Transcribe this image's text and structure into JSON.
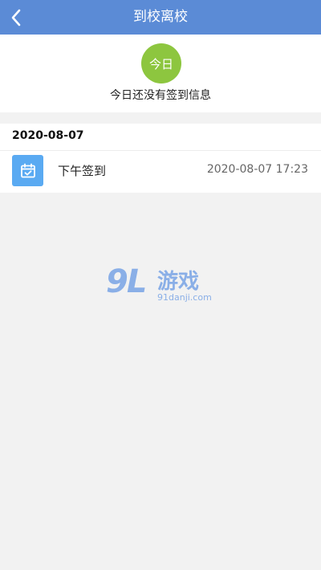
{
  "header": {
    "title": "到校离校",
    "back_icon": "chevron-left-icon",
    "background_color": "#5b8bd6"
  },
  "today": {
    "badge_label": "今日",
    "badge_color": "#8dc63f",
    "message": "今日还没有签到信息"
  },
  "records": {
    "date": "2020-08-07",
    "items": [
      {
        "icon": "calendar-check-icon",
        "label": "下午签到",
        "time": "2020-08-07 17:23"
      }
    ]
  },
  "watermark": {
    "logo_text": "9L",
    "name": "游戏",
    "url": "91danji.com"
  }
}
